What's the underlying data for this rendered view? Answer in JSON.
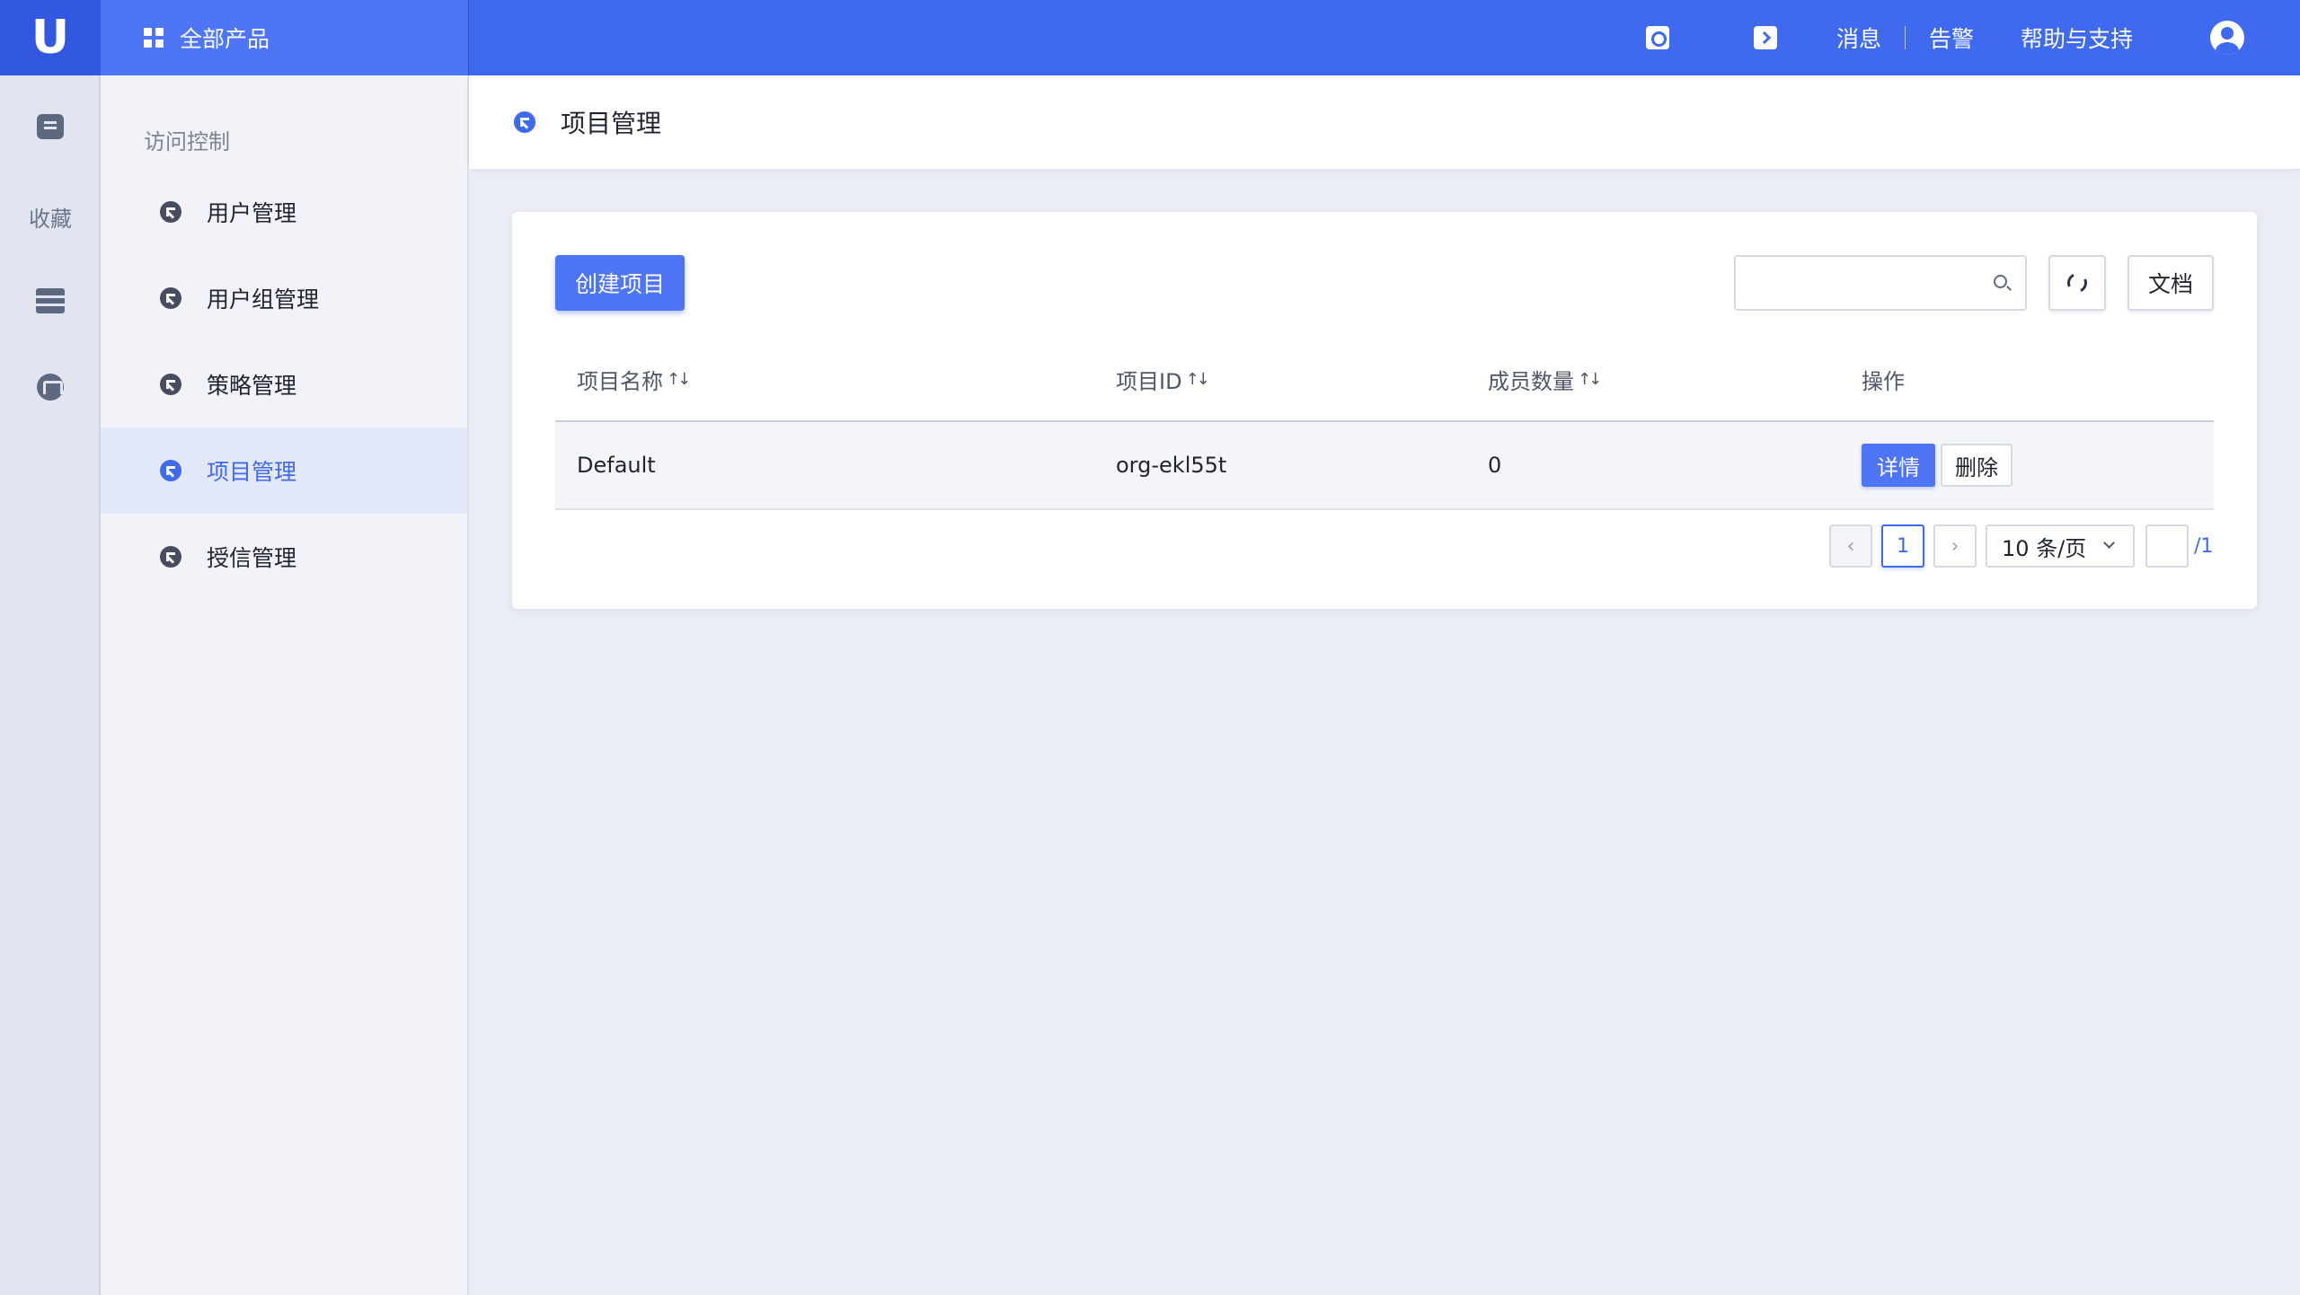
{
  "brand": {
    "logo_letter": "U"
  },
  "topbar": {
    "all_products": "全部产品",
    "icons": [
      "search-icon",
      "terminal-icon"
    ],
    "messages": "消息",
    "alerts": "告警",
    "help": "帮助与支持"
  },
  "rail": {
    "items": [
      {
        "icon": "message-icon"
      },
      {
        "label": "收藏"
      },
      {
        "icon": "server-cloud-icon"
      },
      {
        "icon": "network-icon"
      }
    ]
  },
  "menu": {
    "group_title": "访问控制",
    "items": [
      {
        "label": "用户管理",
        "active": false
      },
      {
        "label": "用户组管理",
        "active": false
      },
      {
        "label": "策略管理",
        "active": false
      },
      {
        "label": "项目管理",
        "active": true
      },
      {
        "label": "授信管理",
        "active": false
      }
    ]
  },
  "page": {
    "title": "项目管理"
  },
  "toolbar": {
    "create_label": "创建项目",
    "search_value": "",
    "docs_label": "文档"
  },
  "table": {
    "columns": [
      "项目名称",
      "项目ID",
      "成员数量",
      "操作"
    ],
    "rows": [
      {
        "name": "Default",
        "id": "org-ekl55t",
        "members": "0",
        "actions": [
          "详情",
          "删除"
        ]
      }
    ]
  },
  "pagination": {
    "prev": "‹",
    "current": "1",
    "next": "›",
    "page_size": "10 条/页",
    "jump_value": "",
    "total": "/1"
  },
  "colors": {
    "primary": "#3f6af0",
    "topbar": "#3f6af0",
    "background": "#ebedf5"
  }
}
